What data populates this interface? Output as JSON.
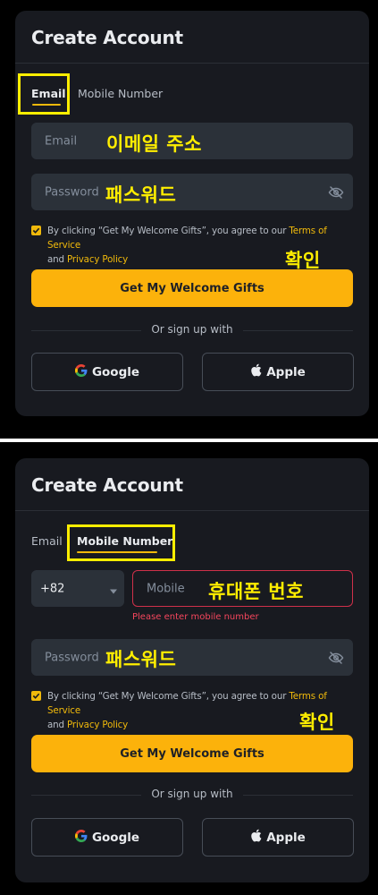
{
  "colors": {
    "accent": "#f0b90b",
    "button": "#fcb20b",
    "error": "#f6465d",
    "annotation": "#ffee00"
  },
  "top": {
    "title": "Create Account",
    "tabs": [
      {
        "label": "Email"
      },
      {
        "label": "Mobile Number"
      }
    ],
    "email_placeholder": "Email",
    "email_annotation": "이메일 주소",
    "password_placeholder": "Password",
    "password_annotation": "패스워드",
    "terms_prefix": "By clicking “Get My Welcome Gifts”, you agree to our ",
    "terms_link": "Terms of Service",
    "terms_and": "and ",
    "privacy_link": "Privacy Policy",
    "confirm_annotation": "확인",
    "submit_label": "Get My Welcome Gifts",
    "or_text": "Or sign up with",
    "google_label": "Google",
    "apple_label": "Apple"
  },
  "bottom": {
    "title": "Create Account",
    "tabs": [
      {
        "label": "Email"
      },
      {
        "label": "Mobile Number"
      }
    ],
    "country_code": "+82",
    "mobile_placeholder": "Mobile",
    "mobile_annotation": "휴대폰 번호",
    "mobile_error": "Please enter mobile number",
    "password_placeholder": "Password",
    "password_annotation": "패스워드",
    "terms_prefix": "By clicking “Get My Welcome Gifts”, you agree to our ",
    "terms_link": "Terms of Service",
    "terms_and": "and ",
    "privacy_link": "Privacy Policy",
    "confirm_annotation": "확인",
    "submit_label": "Get My Welcome Gifts",
    "or_text": "Or sign up with",
    "google_label": "Google",
    "apple_label": "Apple"
  }
}
